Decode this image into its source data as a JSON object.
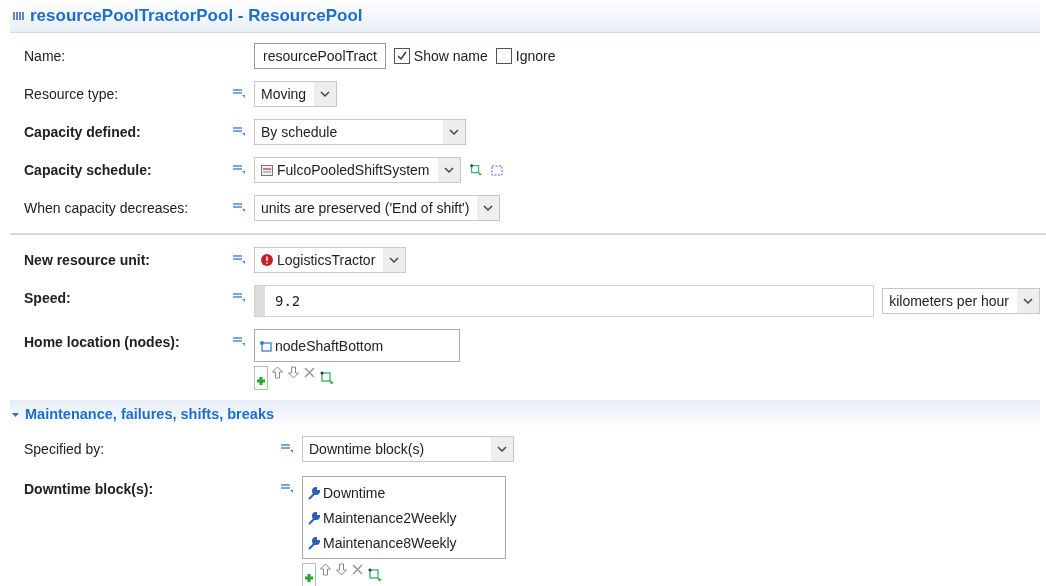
{
  "title": "resourcePoolTractorPool - ResourcePool",
  "groups": [
    {
      "rows": [
        {
          "kind": "name",
          "label": "Name:",
          "bold": false,
          "value": "resourcePoolTract",
          "checks": [
            {
              "label": "Show name",
              "checked": true
            },
            {
              "label": "Ignore",
              "checked": false
            }
          ]
        },
        {
          "kind": "select",
          "label": "Resource type:",
          "bold": false,
          "value": "Moving"
        },
        {
          "kind": "select",
          "label": "Capacity defined:",
          "bold": true,
          "value": "By schedule",
          "wide": true
        },
        {
          "kind": "schedule",
          "label": "Capacity schedule:",
          "bold": true,
          "value": "FulcoPooledShiftSystem"
        },
        {
          "kind": "select",
          "label": "When capacity decreases:",
          "bold": false,
          "value": "units are preserved ('End of shift')"
        }
      ]
    },
    {
      "rows": [
        {
          "kind": "agent",
          "label": "New resource unit:",
          "bold": true,
          "value": "LogisticsTractor"
        },
        {
          "kind": "number",
          "label": "Speed:",
          "bold": true,
          "value": "9.2",
          "unit": "kilometers per hour"
        },
        {
          "kind": "node-list",
          "label": "Home location (nodes):",
          "bold": true,
          "items": [
            "nodeShaftBottom"
          ]
        }
      ]
    }
  ],
  "section": {
    "title": "Maintenance, failures, shifts, breaks",
    "expanded": true,
    "rows": [
      {
        "kind": "select",
        "label": "Specified by:",
        "bold": false,
        "value": "Downtime block(s)",
        "wide": true
      },
      {
        "kind": "block-list",
        "label": "Downtime block(s):",
        "bold": true,
        "items": [
          "Downtime",
          "Maintenance2Weekly",
          "Maintenance8Weekly"
        ]
      }
    ]
  }
}
